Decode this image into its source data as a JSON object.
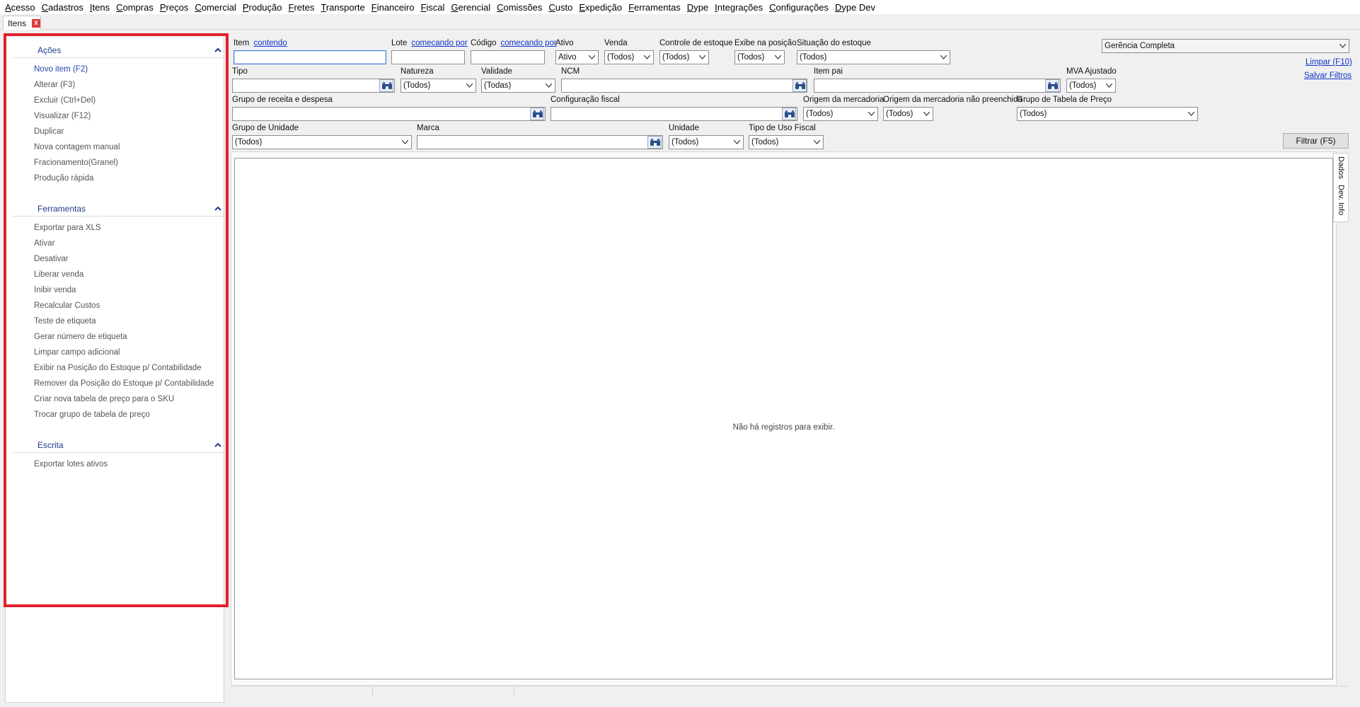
{
  "menu": [
    "Acesso",
    "Cadastros",
    "Itens",
    "Compras",
    "Preços",
    "Comercial",
    "Produção",
    "Fretes",
    "Transporte",
    "Financeiro",
    "Fiscal",
    "Gerencial",
    "Comissões",
    "Custo",
    "Expedição",
    "Ferramentas",
    "Dype",
    "Integrações",
    "Configurações",
    "Dype Dev"
  ],
  "tab": {
    "label": "Itens",
    "close": "x"
  },
  "sidebar": {
    "groups": [
      {
        "title": "Ações",
        "items": [
          "Novo item (F2)",
          "Alterar (F3)",
          "Excluir (Ctrl+Del)",
          "Visualizar (F12)",
          "Duplicar",
          "Nova contagem manual",
          "Fracionamento(Granel)",
          "Produção rápida"
        ]
      },
      {
        "title": "Ferramentas",
        "items": [
          "Exportar para XLS",
          "Ativar",
          "Desativar",
          "Liberar venda",
          "Inibir venda",
          "Recalcular Custos",
          "Teste de etiqueta",
          "Gerar número de etiqueta",
          "Limpar campo adicional",
          "Exibir na Posição do Estoque p/ Contabilidade",
          "Remover da Posição do Estoque p/ Contabilidade",
          "Criar nova tabela de preço para o SKU",
          "Trocar grupo de tabela de preço"
        ]
      },
      {
        "title": "Escrita",
        "items": [
          "Exportar lotes ativos"
        ]
      }
    ]
  },
  "filters": {
    "item": {
      "label": "Item",
      "mode": "contendo",
      "value": ""
    },
    "lote": {
      "label": "Lote",
      "mode": "comecando por",
      "value": ""
    },
    "codigo": {
      "label": "Código",
      "mode": "comecando por",
      "value": ""
    },
    "ativo": {
      "label": "Ativo",
      "value": "Ativo"
    },
    "venda": {
      "label": "Venda",
      "value": "(Todos)"
    },
    "controle_estoque": {
      "label": "Controle de estoque",
      "value": "(Todos)"
    },
    "exibe_posicao": {
      "label": "Exibe na posição",
      "value": "(Todos)"
    },
    "situacao_estoque": {
      "label": "Situação do estoque",
      "value": "(Todos)"
    },
    "perfil": {
      "value": "Gerência Completa"
    },
    "tipo": {
      "label": "Tipo",
      "value": ""
    },
    "natureza": {
      "label": "Natureza",
      "value": "(Todos)"
    },
    "validade": {
      "label": "Validade",
      "value": "(Todas)"
    },
    "ncm": {
      "label": "NCM",
      "value": ""
    },
    "item_pai": {
      "label": "Item pai",
      "value": ""
    },
    "mva": {
      "label": "MVA Ajustado",
      "value": "(Todos)"
    },
    "grupo_receita": {
      "label": "Grupo de receita e despesa",
      "value": ""
    },
    "config_fiscal": {
      "label": "Configuração fiscal",
      "value": ""
    },
    "origem": {
      "label": "Origem da mercadoria",
      "value": "(Todos)"
    },
    "origem_nao": {
      "label": "Origem da mercadoria não preenchida",
      "value": "(Todos)"
    },
    "grupo_tabela": {
      "label": "Grupo de Tabela de Preço",
      "value": "(Todos)"
    },
    "grupo_unidade": {
      "label": "Grupo de Unidade",
      "value": "(Todos)"
    },
    "marca": {
      "label": "Marca",
      "value": ""
    },
    "unidade": {
      "label": "Unidade",
      "value": "(Todos)"
    },
    "tipo_uso": {
      "label": "Tipo de Uso Fiscal",
      "value": "(Todos)"
    }
  },
  "links": {
    "limpar": "Limpar (F10)",
    "salvar": "Salvar Filtros"
  },
  "filtrar_button": "Filtrar (F5)",
  "grid": {
    "empty_message": "Não há registros para exibir."
  },
  "side_tabs": [
    "Dados",
    "Dev. Info"
  ],
  "colors": {
    "highlight": "#e2202c",
    "link": "#1133cc",
    "header": "#1f3a8a"
  }
}
